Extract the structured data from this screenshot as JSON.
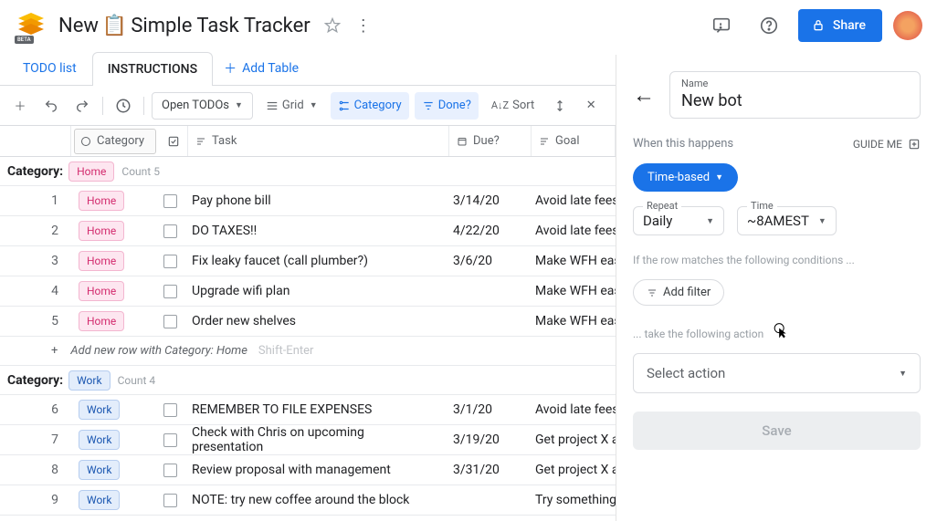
{
  "header": {
    "title_prefix": "New",
    "title_suffix": "Simple Task Tracker",
    "share_label": "Share",
    "logo_tag": "BETA"
  },
  "tabs": {
    "items": [
      {
        "label": "TODO list",
        "active": false
      },
      {
        "label": "INSTRUCTIONS",
        "active": true
      }
    ],
    "add_table": "Add Table"
  },
  "toolbar": {
    "view_name": "Open TODOs",
    "layout": "Grid",
    "group_by": "Category",
    "filter_by": "Done?",
    "sort": "Sort"
  },
  "columns": {
    "category": "Category",
    "task": "Task",
    "due": "Due?",
    "goal": "Goal"
  },
  "groups": [
    {
      "label": "Category:",
      "chip": "Home",
      "chip_class": "chip-home",
      "count_label": "Count",
      "count": "5",
      "rows": [
        {
          "n": "1",
          "cat": "Home",
          "task": "Pay phone bill",
          "due": "3/14/20",
          "goal": "Avoid late fees"
        },
        {
          "n": "2",
          "cat": "Home",
          "task": "DO TAXES!!",
          "due": "4/22/20",
          "goal": "Avoid late fees"
        },
        {
          "n": "3",
          "cat": "Home",
          "task": "Fix leaky faucet (call plumber?)",
          "due": "3/6/20",
          "goal": "Make WFH easi"
        },
        {
          "n": "4",
          "cat": "Home",
          "task": "Upgrade wifi plan",
          "due": "",
          "goal": "Make WFH easi"
        },
        {
          "n": "5",
          "cat": "Home",
          "task": "Order new shelves",
          "due": "",
          "goal": "Make WFH easi"
        }
      ],
      "add_row_text": "Add new row with Category: Home",
      "add_row_hint": "Shift-Enter"
    },
    {
      "label": "Category:",
      "chip": "Work",
      "chip_class": "chip-work",
      "count_label": "Count",
      "count": "4",
      "rows": [
        {
          "n": "6",
          "cat": "Work",
          "task": "REMEMBER TO FILE EXPENSES",
          "due": "3/1/20",
          "goal": "Avoid late fees"
        },
        {
          "n": "7",
          "cat": "Work",
          "task": "Check with Chris on upcoming presentation",
          "due": "3/19/20",
          "goal": "Get project X ap"
        },
        {
          "n": "8",
          "cat": "Work",
          "task": "Review proposal with management",
          "due": "3/31/20",
          "goal": "Get project X ap"
        },
        {
          "n": "9",
          "cat": "Work",
          "task": "NOTE: try new coffee around the block",
          "due": "",
          "goal": "Try something d"
        }
      ]
    }
  ],
  "panel": {
    "name_label": "Name",
    "name_value": "New bot",
    "when_label": "When this happens",
    "guide": "GUIDE ME",
    "trigger": "Time-based",
    "repeat_label": "Repeat",
    "repeat_value": "Daily",
    "time_label": "Time",
    "time_value": "~8AMEST",
    "condition_text": "If the row matches the following conditions ...",
    "add_filter": "Add filter",
    "action_text": "... take the following action",
    "select_action": "Select action",
    "save": "Save"
  }
}
